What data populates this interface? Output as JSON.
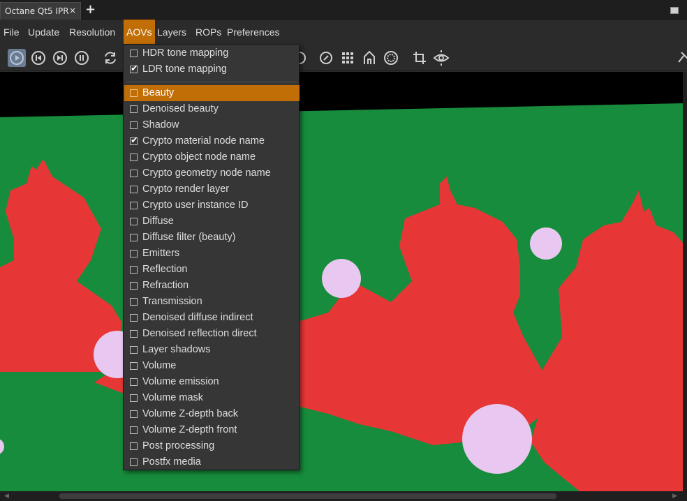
{
  "tabbar": {
    "tab_title": "Octane Qt5 IPR",
    "close_glyph": "×",
    "add_glyph": "+"
  },
  "menubar": {
    "items": [
      "File",
      "Update",
      "Resolution",
      "AOVs",
      "Layers",
      "ROPs",
      "Preferences"
    ],
    "active": "AOVs"
  },
  "toolbar": {
    "icons": [
      "play-icon",
      "skip-back-icon",
      "skip-forward-icon",
      "pause-icon",
      "refresh-icon",
      "eye-ring-icon",
      "clock-dial-icon",
      "grid-icon",
      "home-icon",
      "dotted-circle-icon",
      "crop-icon",
      "eye-pick-icon",
      "pin-icon"
    ]
  },
  "aov_menu": {
    "tone_items": [
      {
        "label": "HDR tone mapping",
        "checked": false
      },
      {
        "label": "LDR tone mapping",
        "checked": true
      }
    ],
    "aov_items": [
      {
        "label": "Beauty",
        "checked": false,
        "highlighted": true
      },
      {
        "label": "Denoised beauty",
        "checked": false
      },
      {
        "label": "Shadow",
        "checked": false
      },
      {
        "label": "Crypto material node name",
        "checked": true
      },
      {
        "label": "Crypto object node name",
        "checked": false
      },
      {
        "label": "Crypto geometry node name",
        "checked": false
      },
      {
        "label": "Crypto render layer",
        "checked": false
      },
      {
        "label": "Crypto user instance ID",
        "checked": false
      },
      {
        "label": "Diffuse",
        "checked": false
      },
      {
        "label": "Diffuse filter (beauty)",
        "checked": false
      },
      {
        "label": "Emitters",
        "checked": false
      },
      {
        "label": "Reflection",
        "checked": false
      },
      {
        "label": "Refraction",
        "checked": false
      },
      {
        "label": "Transmission",
        "checked": false
      },
      {
        "label": "Denoised diffuse indirect",
        "checked": false
      },
      {
        "label": "Denoised reflection direct",
        "checked": false
      },
      {
        "label": "Layer shadows",
        "checked": false
      },
      {
        "label": "Volume",
        "checked": false
      },
      {
        "label": "Volume emission",
        "checked": false
      },
      {
        "label": "Volume mask",
        "checked": false
      },
      {
        "label": "Volume Z-depth back",
        "checked": false
      },
      {
        "label": "Volume Z-depth front",
        "checked": false
      },
      {
        "label": "Post processing",
        "checked": false
      },
      {
        "label": "Postfx media",
        "checked": false
      }
    ]
  },
  "colors": {
    "accent": "#c16e07",
    "render_green": "#178c3c",
    "render_red": "#e73636",
    "render_lilac": "#e8c8f0"
  }
}
